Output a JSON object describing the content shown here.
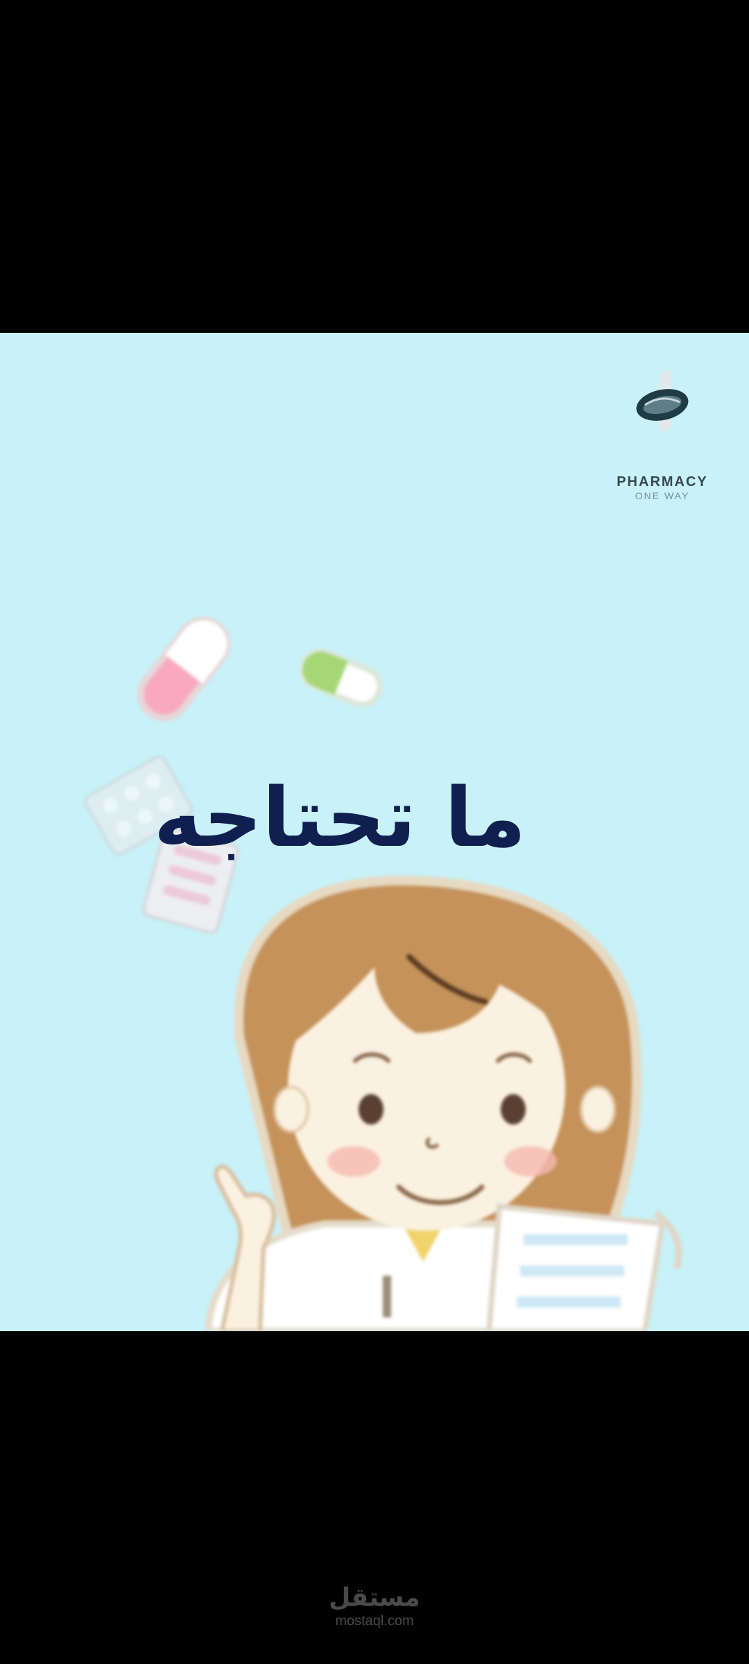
{
  "video": {
    "headline": "ما تحتاجه",
    "brand": {
      "name": "PHARMACY",
      "tagline": "ONE WAY",
      "icon": "pharmacy-pill-logo-icon"
    },
    "illustration": {
      "subject": "pharmacist-pointing-icon",
      "items": [
        "pill-capsule-icon",
        "pill-capsule-icon",
        "blister-pack-icon",
        "blister-pack-icon",
        "clipboard-icon"
      ]
    }
  },
  "watermark": {
    "arabic": "مستقل",
    "latin": "mostaql.com"
  },
  "colors": {
    "background": "#c8f2f8",
    "headline": "#0f1f4f",
    "hair": "#c4925a",
    "skin": "#fbf1e1",
    "letterbox": "#000000"
  }
}
